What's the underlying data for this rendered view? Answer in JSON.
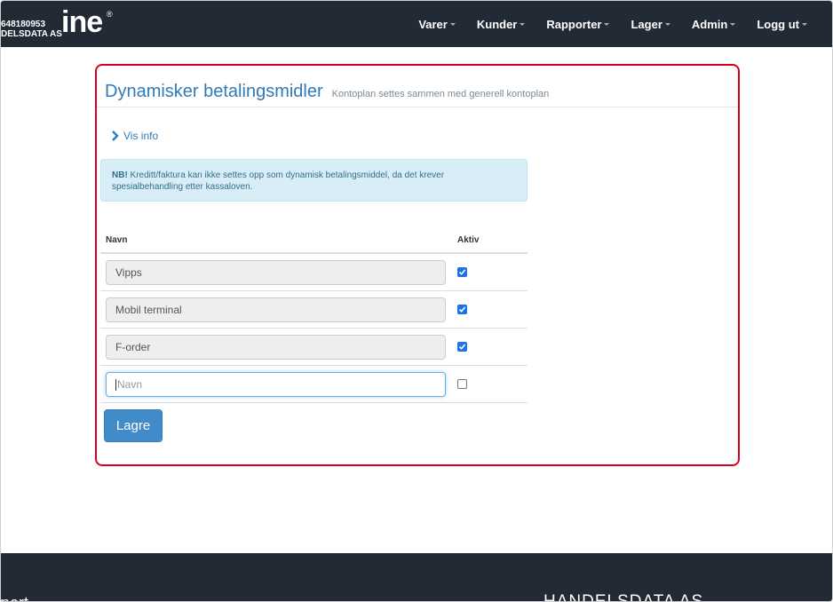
{
  "header": {
    "org_number": "648180953",
    "org_name": "DELSDATA AS",
    "logo_text": "ine",
    "logo_mark": "®",
    "nav": [
      {
        "label": "Varer"
      },
      {
        "label": "Kunder"
      },
      {
        "label": "Rapporter"
      },
      {
        "label": "Lager"
      },
      {
        "label": "Admin"
      },
      {
        "label": "Logg ut"
      }
    ]
  },
  "panel": {
    "title": "Dynamisker betalingsmidler",
    "subtitle": "Kontoplan settes sammen med generell kontoplan",
    "vis_info": "Vis info",
    "alert_strong": "NB!",
    "alert_text": " Kreditt/faktura kan ikke settes opp som dynamisk betalingsmiddel, da det krever spesialbehandling etter kassaloven.",
    "columns": {
      "name": "Navn",
      "active": "Aktiv"
    },
    "rows": [
      {
        "name": "Vipps",
        "active": true
      },
      {
        "name": "Mobil terminal",
        "active": true
      },
      {
        "name": "F-order",
        "active": true
      }
    ],
    "new_row": {
      "placeholder": "Navn",
      "active": false
    },
    "save_label": "Lagre"
  },
  "footer": {
    "left_text": "port",
    "right_text": "HANDELSDATA AS"
  },
  "colors": {
    "navbar": "#222a35",
    "accent": "#2f7ab8",
    "highlight": "#d9001b",
    "button": "#428bca",
    "alert_bg": "#d9edf7"
  }
}
